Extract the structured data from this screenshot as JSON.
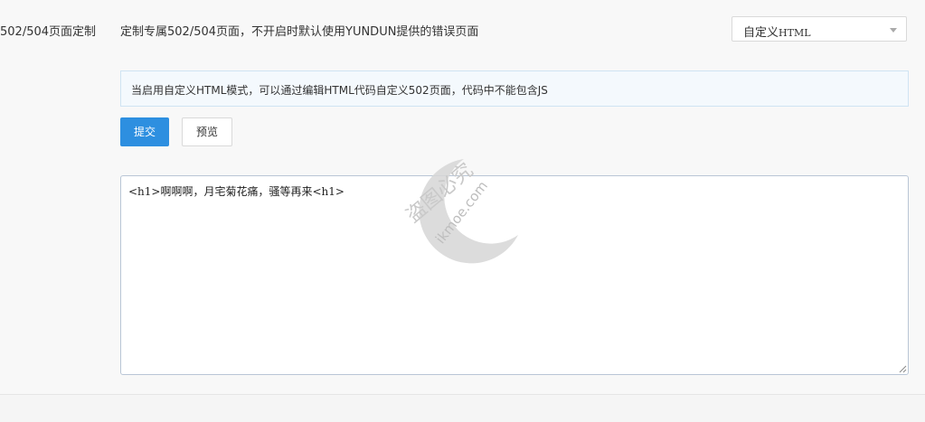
{
  "setting": {
    "label": "502/504页面定制",
    "description": "定制专属502/504页面，不开启时默认使用YUNDUN提供的错误页面",
    "select": {
      "value_prefix": "自定义",
      "value_suffix": "HTML"
    }
  },
  "notice": {
    "text": "当启用自定义HTML模式，可以通过编辑HTML代码自定义502页面，代码中不能包含JS"
  },
  "buttons": {
    "submit_label": "提交",
    "preview_label": "预览"
  },
  "editor": {
    "content": "<h1>啊啊啊，月宅菊花痛，骚等再来<h1>"
  },
  "watermark": {
    "cn": "盗图必究",
    "en": "ikmoe.com"
  },
  "colors": {
    "primary": "#2d8fe0",
    "notice_bg": "#f4f9fd",
    "notice_border": "#cfe4f3"
  },
  "icons": {
    "select_caret": "chevron-down-icon",
    "editor_resize": "resize-handle-icon",
    "watermark_logo": "crescent-moon-icon"
  }
}
